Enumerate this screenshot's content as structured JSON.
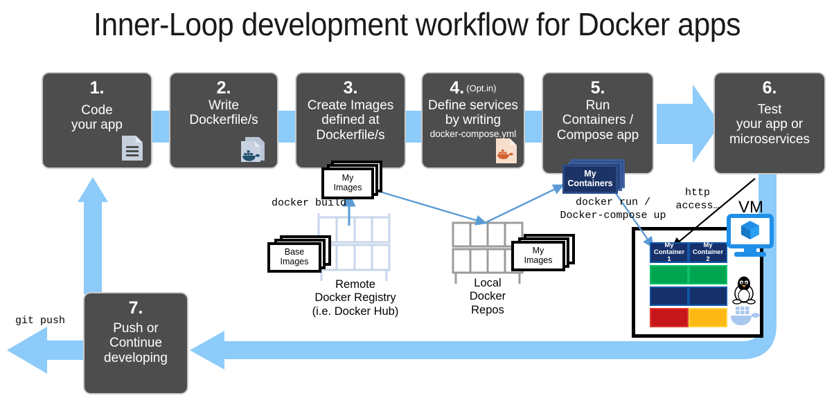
{
  "title": "Inner-Loop development workflow for Docker apps",
  "steps": [
    {
      "num": "1.",
      "optin": "",
      "body": "Code\nyour app",
      "sub": "",
      "icon": "document-icon"
    },
    {
      "num": "2.",
      "optin": "",
      "body": "Write\nDockerfile/s",
      "sub": "",
      "icon": "dockerfile-icon"
    },
    {
      "num": "3.",
      "optin": "",
      "body": "Create Images\ndefined at\nDockerfile/s",
      "sub": "",
      "icon": ""
    },
    {
      "num": "4.",
      "optin": "(Opt.in)",
      "body": "Define services\nby writing",
      "sub": "docker-compose.yml",
      "icon": "compose-file-icon"
    },
    {
      "num": "5.",
      "optin": "",
      "body": "Run\nContainers /\nCompose app",
      "sub": "",
      "icon": ""
    },
    {
      "num": "6.",
      "optin": "",
      "body": "Test\nyour app or\nmicroservices",
      "sub": "",
      "icon": ""
    },
    {
      "num": "7.",
      "optin": "",
      "body": "Push or\nContinue\ndeveloping",
      "sub": "",
      "icon": ""
    }
  ],
  "chips": {
    "my_images_top": "My\nImages",
    "base_images": "Base\nImages",
    "my_images_local": "My\nImages",
    "my_containers": "My\nContainers"
  },
  "labels": {
    "docker_build": "docker build",
    "docker_run": "docker run /\nDocker-compose up",
    "git_push": "git push",
    "http_access": "http\naccess…",
    "remote_registry": "Remote\nDocker Registry\n(i.e. Docker Hub)",
    "local_repos": "Local\nDocker\nRepos",
    "vm": "VM"
  },
  "vm": {
    "containers": [
      {
        "name": "My\nContainer 1",
        "segments": [
          "green",
          "navy",
          "red"
        ]
      },
      {
        "name": "My\nContainer 2",
        "segments": [
          "green",
          "navy",
          "yellow"
        ]
      }
    ],
    "os_icon": "linux-penguin-icon",
    "engine_icon": "docker-whale-icon",
    "vm_icon": "vm-monitor-icon"
  },
  "colors": {
    "accent_blue": "#8ccbfa",
    "box_gray": "#4d4d4d",
    "navy": "#16306b",
    "green": "#00a550",
    "red": "#c8161d",
    "yellow": "#fdb913",
    "arrow_blue": "#4a90d9",
    "vm_blue": "#1f8fe8"
  }
}
